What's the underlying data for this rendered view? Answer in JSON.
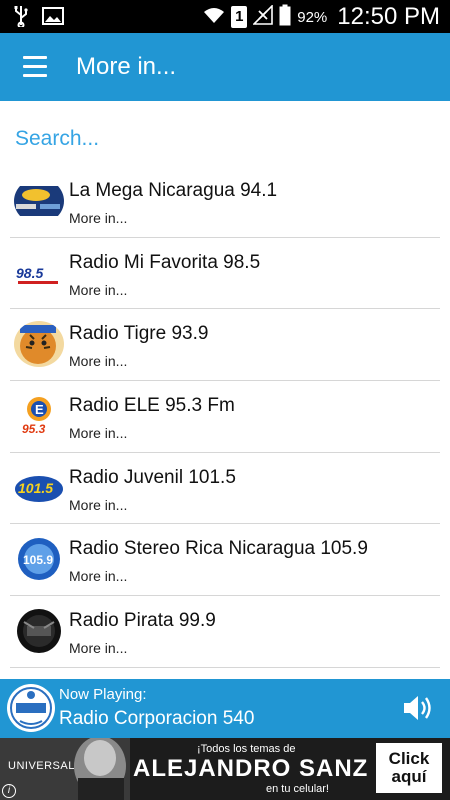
{
  "status_bar": {
    "battery": "92%",
    "sim": "1",
    "time": "12:50 PM"
  },
  "app_bar": {
    "title": "More in..."
  },
  "search": {
    "placeholder": "Search..."
  },
  "stations": [
    {
      "name": "La Mega Nicaragua 94.1",
      "subtitle": "More in...",
      "logo_color": "#1a3a7a"
    },
    {
      "name": "Radio Mi Favorita 98.5",
      "subtitle": "More in...",
      "logo_color": "#ffffff"
    },
    {
      "name": "Radio Tigre 93.9",
      "subtitle": "More in...",
      "logo_color": "#e08a2a"
    },
    {
      "name": "Radio ELE 95.3 Fm",
      "subtitle": "More in...",
      "logo_color": "#f4a020"
    },
    {
      "name": "Radio Juvenil 101.5",
      "subtitle": "More in...",
      "logo_color": "#1a4fb0"
    },
    {
      "name": "Radio Stereo Rica Nicaragua 105.9",
      "subtitle": "More in...",
      "logo_color": "#1f5fc0"
    },
    {
      "name": "Radio Pirata 99.9",
      "subtitle": "More in...",
      "logo_color": "#111111"
    }
  ],
  "now_playing": {
    "label": "Now Playing:",
    "station": "Radio Corporacion 540"
  },
  "ad": {
    "brand": "UNIVERSAL",
    "headline_top": "¡Todos los temas de",
    "artist": "ALEJANDRO SANZ",
    "headline_bottom": "en tu celular!",
    "cta": "Click aquí"
  },
  "colors": {
    "primary": "#2196d3",
    "search_text": "#35a4e4"
  }
}
